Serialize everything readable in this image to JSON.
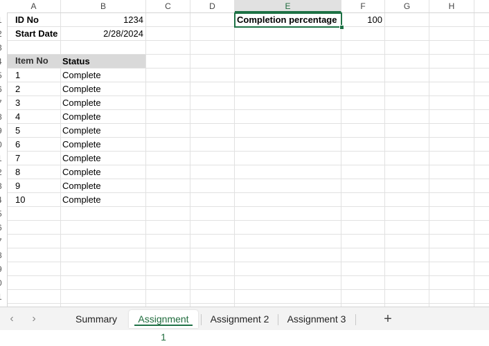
{
  "sheet": {
    "columns": [
      "A",
      "B",
      "C",
      "D",
      "E",
      "F",
      "G",
      "H"
    ],
    "row_numbers": [
      "1",
      "2",
      "3",
      "4",
      "5",
      "6",
      "7",
      "8",
      "9",
      "0",
      "1",
      "2",
      "3",
      "4",
      "5",
      "6",
      "7",
      "8",
      "9",
      "0",
      "1"
    ],
    "id_label": "ID No",
    "id_value": "1234",
    "start_label": "Start Date",
    "start_value": "2/28/2024",
    "completion_label": "Completion percentage",
    "completion_value": "100",
    "table_headers": {
      "item": "Item No",
      "status": "Status"
    },
    "rows": [
      {
        "item": "1",
        "status": "Complete"
      },
      {
        "item": "2",
        "status": "Complete"
      },
      {
        "item": "3",
        "status": "Complete"
      },
      {
        "item": "4",
        "status": "Complete"
      },
      {
        "item": "5",
        "status": "Complete"
      },
      {
        "item": "6",
        "status": "Complete"
      },
      {
        "item": "7",
        "status": "Complete"
      },
      {
        "item": "8",
        "status": "Complete"
      },
      {
        "item": "9",
        "status": "Complete"
      },
      {
        "item": "10",
        "status": "Complete"
      }
    ]
  },
  "tabs": {
    "prev": "‹",
    "next": "›",
    "items": [
      "Summary",
      "Assignment 1",
      "Assignment 2",
      "Assignment 3"
    ],
    "active": "Assignment 1",
    "add": "+"
  },
  "colors": {
    "accent": "#1e7145",
    "header_shade": "#d9d9d9"
  }
}
